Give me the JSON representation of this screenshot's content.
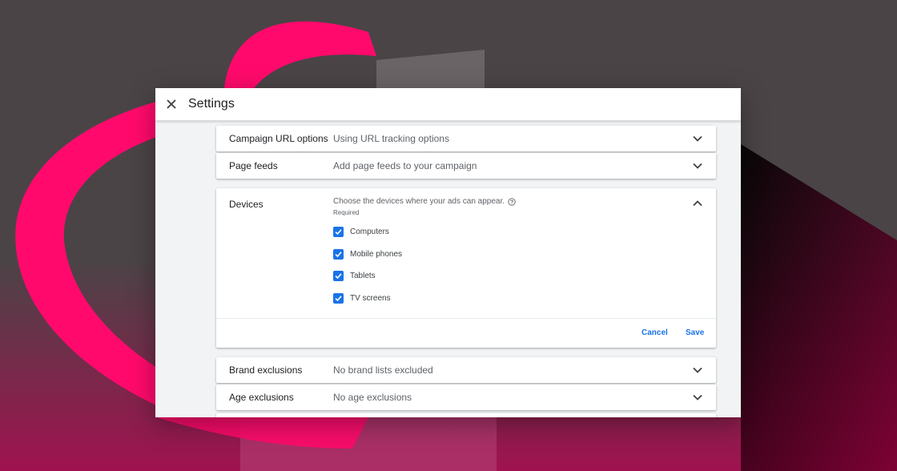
{
  "header": {
    "title": "Settings",
    "close_icon": "close-icon"
  },
  "rows_top": [
    {
      "label": "Campaign URL options",
      "value": "Using URL tracking options"
    },
    {
      "label": "Page feeds",
      "value": "Add page feeds to your campaign"
    }
  ],
  "devices": {
    "label": "Devices",
    "description": "Choose the devices where your ads can appear.",
    "required": "Required",
    "options": [
      {
        "label": "Computers",
        "checked": true
      },
      {
        "label": "Mobile phones",
        "checked": true
      },
      {
        "label": "Tablets",
        "checked": true
      },
      {
        "label": "TV screens",
        "checked": true
      }
    ],
    "cancel": "Cancel",
    "save": "Save"
  },
  "rows_bottom": [
    {
      "label": "Brand exclusions",
      "value": "No brand lists excluded"
    },
    {
      "label": "Age exclusions",
      "value": "No age exclusions"
    }
  ],
  "colors": {
    "accent": "#1a73e8",
    "brand_pink": "#ff0a6c"
  }
}
